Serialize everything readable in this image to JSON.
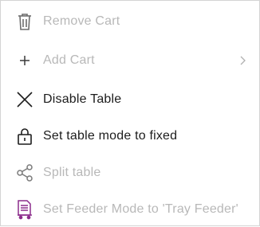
{
  "menu": {
    "items": [
      {
        "label": "Remove Cart",
        "icon": "trash-icon",
        "enabled": false
      },
      {
        "label": "Add Cart",
        "icon": "plus-icon",
        "enabled": false,
        "has_submenu": true
      },
      {
        "label": "Disable Table",
        "icon": "x-icon",
        "enabled": true
      },
      {
        "label": "Set table mode to fixed",
        "icon": "lock-icon",
        "enabled": true
      },
      {
        "label": "Split table",
        "icon": "share-icon",
        "enabled": false
      },
      {
        "label": "Set Feeder Mode to 'Tray Feeder'",
        "icon": "tray-feeder-icon",
        "enabled": false
      }
    ]
  },
  "colors": {
    "text": "#1c1c1c",
    "disabled_text": "#b8b8b8",
    "disabled_icon": "#a0a0a0",
    "feeder_icon": "#8c2d8c",
    "border": "#d4d4d4"
  }
}
